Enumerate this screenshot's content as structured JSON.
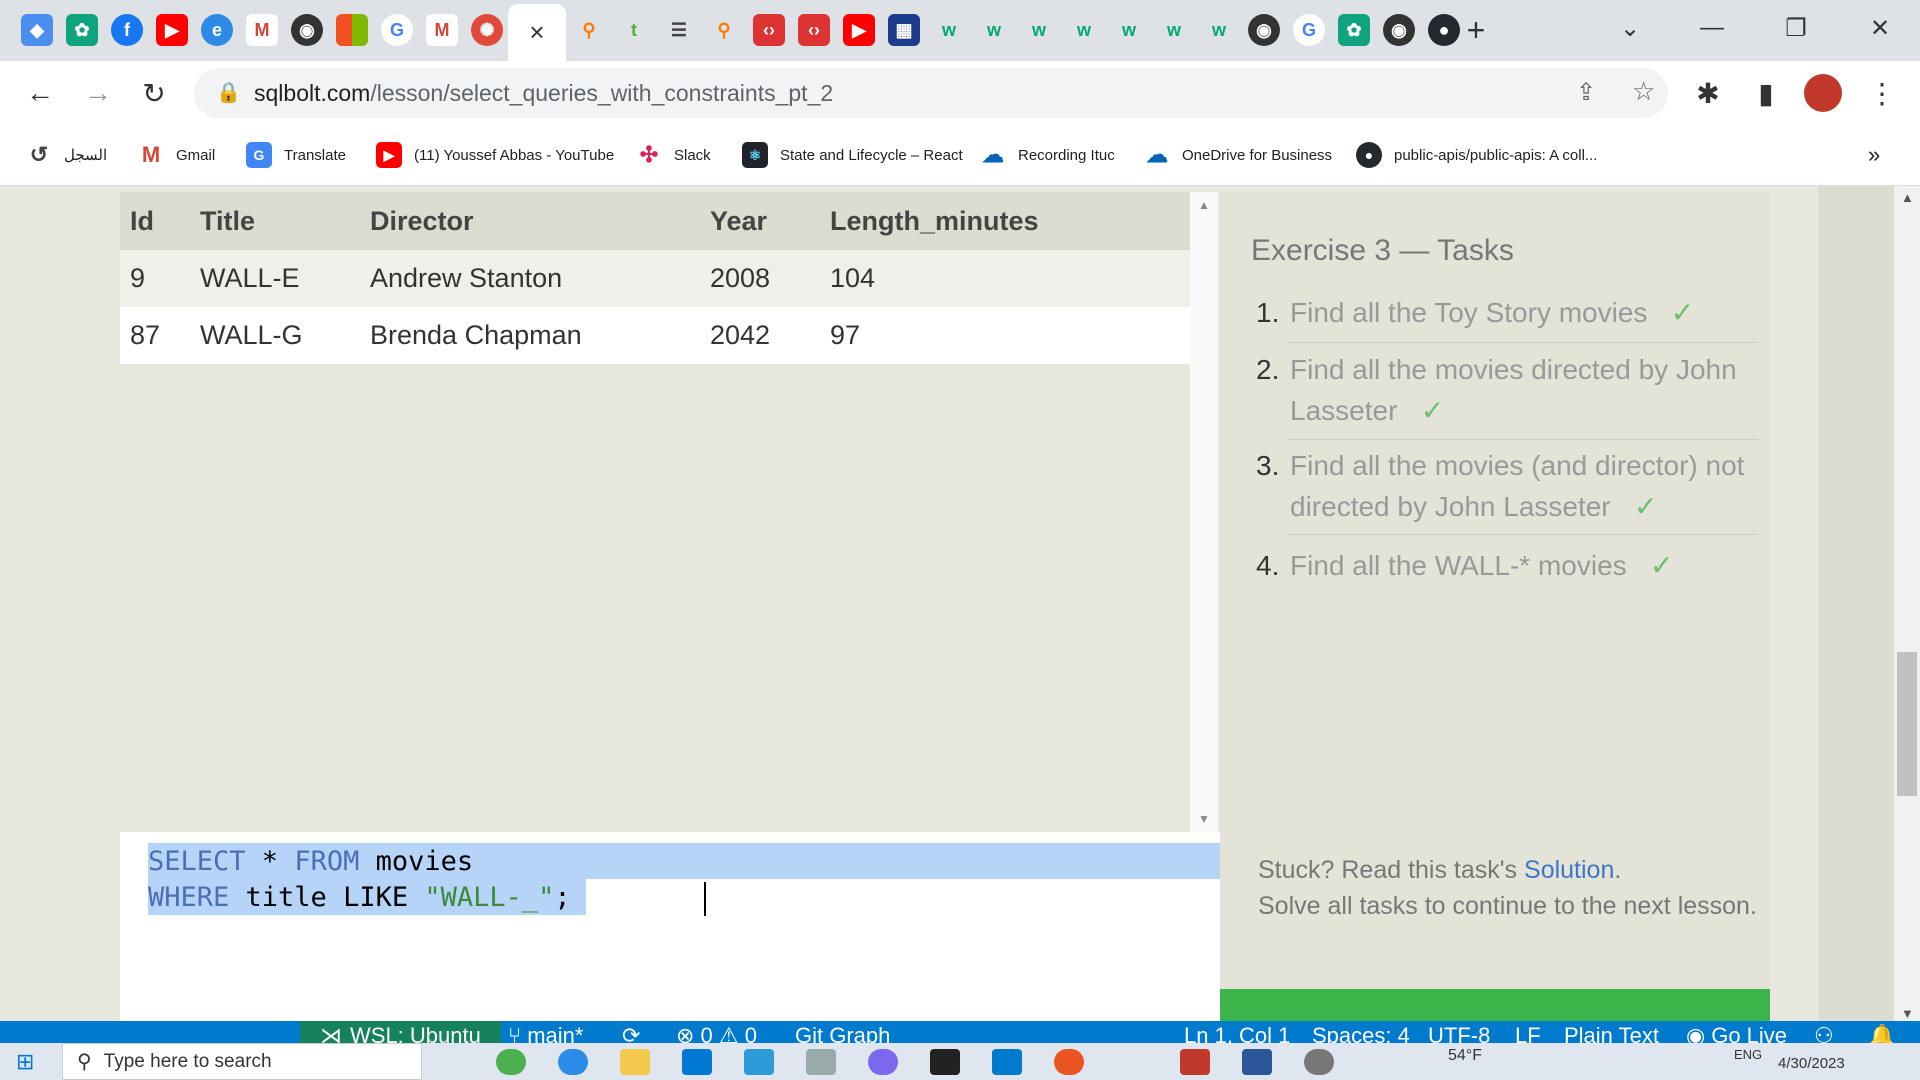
{
  "browser": {
    "active_tab_close": "×",
    "new_tab": "+",
    "url_host": "sqlbolt.com",
    "url_path": "/lesson/select_queries_with_constraints_pt_2",
    "bookmarks": [
      {
        "label": "السجل",
        "icon": "history-icon"
      },
      {
        "label": "Gmail",
        "icon": "gmail-icon"
      },
      {
        "label": "Translate",
        "icon": "translate-icon"
      },
      {
        "label": "(11) Youssef Abbas - YouTube",
        "icon": "youtube-icon"
      },
      {
        "label": "Slack",
        "icon": "slack-icon"
      },
      {
        "label": "State and Lifecycle – React",
        "icon": "react-icon"
      },
      {
        "label": "Recording Ituc",
        "icon": "onedrive-icon"
      },
      {
        "label": "OneDrive for Business",
        "icon": "onedrive-icon"
      },
      {
        "label": "public-apis/public-apis: A coll...",
        "icon": "github-icon"
      }
    ],
    "bookmarks_more": "»"
  },
  "results": {
    "headers": [
      "Id",
      "Title",
      "Director",
      "Year",
      "Length_minutes"
    ],
    "rows": [
      [
        "9",
        "WALL-E",
        "Andrew Stanton",
        "2008",
        "104"
      ],
      [
        "87",
        "WALL-G",
        "Brenda Chapman",
        "2042",
        "97"
      ]
    ]
  },
  "editor": {
    "line1": {
      "kw1": "SELECT",
      "mid": " * ",
      "kw2": "FROM",
      "rest": " movies"
    },
    "line2": {
      "kw1": "WHERE",
      "mid": " title LIKE ",
      "str": "\"WALL-_\"",
      "end": ";"
    }
  },
  "tasks": {
    "title": "Exercise 3 — Tasks",
    "items": [
      {
        "num": "1.",
        "text": "Find all the Toy Story movies",
        "check": "✓"
      },
      {
        "num": "2.",
        "text": "Find all the movies directed by John Lasseter",
        "check": "✓"
      },
      {
        "num": "3.",
        "text": "Find all the movies (and director) not directed by John Lasseter",
        "check": "✓"
      },
      {
        "num": "4.",
        "text": "Find all the WALL-* movies",
        "check": "✓"
      }
    ],
    "stuck_prefix": "Stuck? Read this task's ",
    "stuck_link": "Solution",
    "stuck_suffix": ".",
    "stuck_line2": "Solve all tasks to continue to the next lesson."
  },
  "statusbar": {
    "remote": "WSL: Ubuntu",
    "branch": "main*",
    "problems": "⊗ 0 ⚠ 0",
    "git_graph": "Git Graph",
    "position": "Ln 1, Col 1",
    "spaces": "Spaces: 4",
    "encoding": "UTF-8",
    "eol": "LF",
    "language": "Plain Text",
    "go_live": "Go Live"
  },
  "taskbar": {
    "search_placeholder": "Type here to search",
    "temperature": "54°F",
    "lang": "ENG",
    "date": "4/30/2023"
  },
  "colors": {
    "accent_green": "#3bb54a",
    "statusbar_blue": "#007acc",
    "selection": "#b6d4f8"
  }
}
